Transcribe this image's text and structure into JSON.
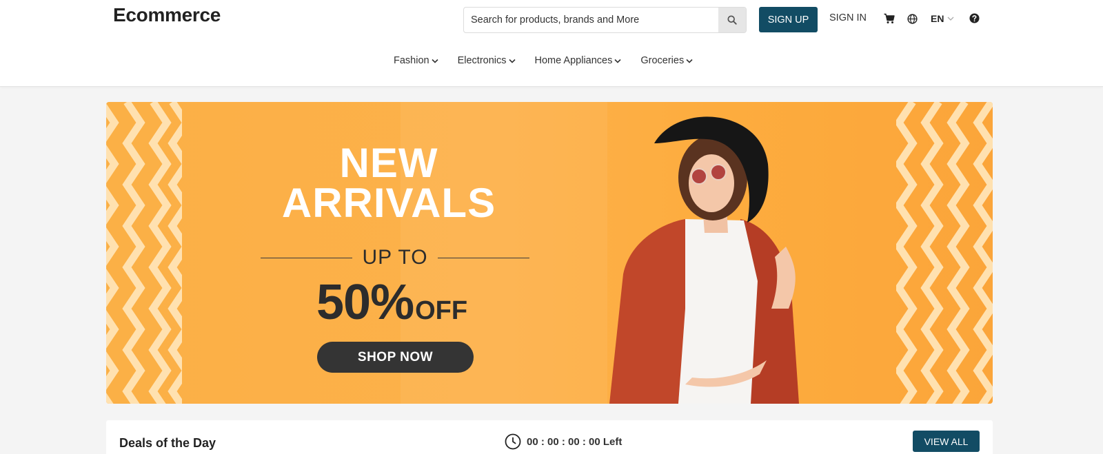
{
  "brand": {
    "logo_text": "Ecommerce"
  },
  "header": {
    "search_placeholder": "Search for products, brands and More",
    "search_icon": "search-icon",
    "signup_label": "SIGN UP",
    "signin_label": "SIGN IN",
    "cart_icon": "cart-icon",
    "globe_icon": "globe-icon",
    "language": "EN",
    "help_icon": "help-icon"
  },
  "nav": {
    "items": [
      {
        "label": "Fashion"
      },
      {
        "label": "Electronics"
      },
      {
        "label": "Home Appliances"
      },
      {
        "label": "Groceries"
      }
    ]
  },
  "banner": {
    "headline_line1": "NEW",
    "headline_line2": "ARRIVALS",
    "subline": "UP TO",
    "discount_value": "50%",
    "discount_suffix": "OFF",
    "cta_label": "SHOP NOW",
    "background_color": "#fdb14a"
  },
  "deals": {
    "title": "Deals of the Day",
    "countdown": "00 : 00 : 00 : 00 Left",
    "view_all_label": "VIEW ALL",
    "clock_icon": "clock-icon"
  },
  "colors": {
    "primary": "#124c64",
    "banner_orange": "#fdb14a",
    "dark_button": "#343434"
  }
}
